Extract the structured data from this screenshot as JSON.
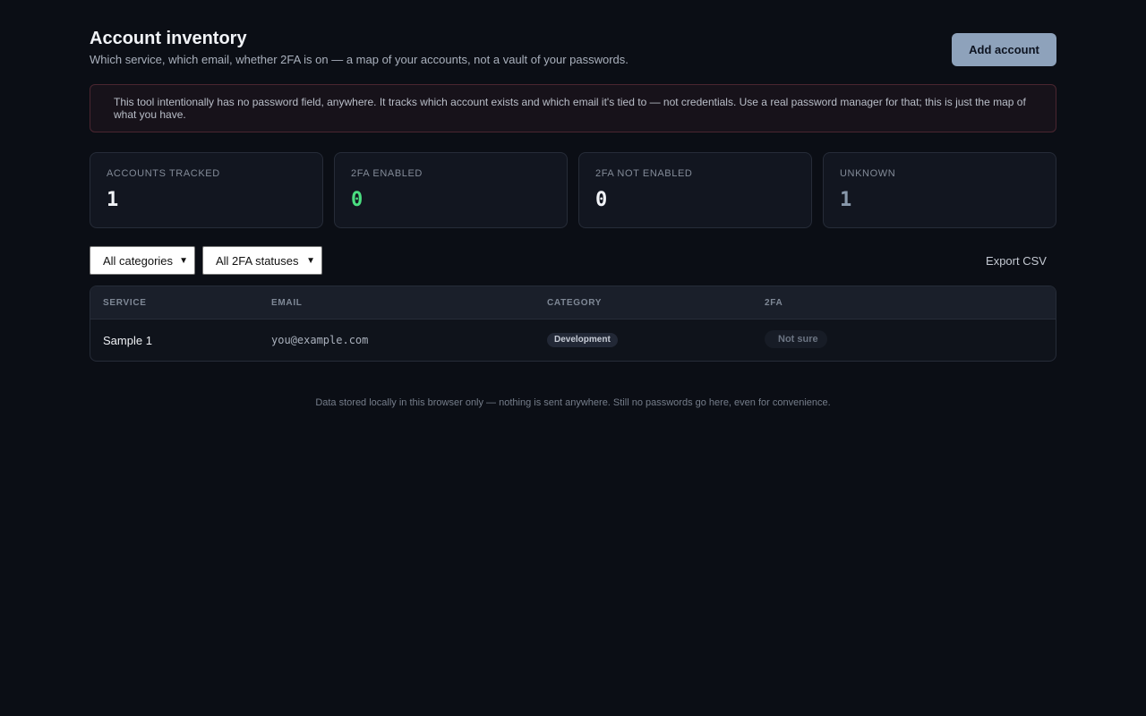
{
  "header": {
    "title": "Account inventory",
    "subtitle": "Which service, which email, whether 2FA is on — a map of your accounts, not a vault of your passwords.",
    "add_button": "Add account"
  },
  "notice": {
    "text": "This tool intentionally has no password field, anywhere. It tracks which account exists and which email it's tied to — not credentials. Use a real password manager for that; this is just the map of what you have."
  },
  "stats": [
    {
      "label": "ACCOUNTS TRACKED",
      "value": "1",
      "color": "#f1f3f7"
    },
    {
      "label": "2FA ENABLED",
      "value": "0",
      "color": "#4ade80"
    },
    {
      "label": "2FA NOT ENABLED",
      "value": "0",
      "color": "#f1f3f7"
    },
    {
      "label": "UNKNOWN",
      "value": "1",
      "color": "#8898ab"
    }
  ],
  "filters": {
    "category_selected": "All categories",
    "status_selected": "All 2FA statuses",
    "export_label": "Export CSV"
  },
  "table": {
    "columns": [
      "SERVICE",
      "EMAIL",
      "CATEGORY",
      "2FA"
    ],
    "rows": [
      {
        "service": "Sample 1",
        "email": "you@example.com",
        "category": "Development",
        "tfa": "Not sure"
      }
    ]
  },
  "footer": {
    "text": "Data stored locally in this browser only — nothing is sent anywhere. Still no passwords go here, even for convenience."
  },
  "colors": {
    "background": "#0b0e15",
    "accent_button": "#8ea2bb",
    "notice_border": "#4a2630",
    "enabled_green": "#4ade80"
  }
}
